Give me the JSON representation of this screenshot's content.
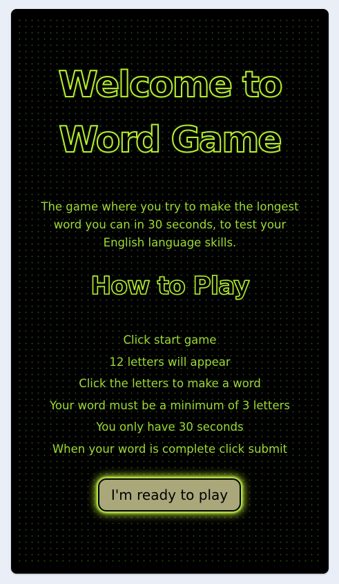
{
  "game": {
    "title_line1": "Welcome to",
    "title_line2": "Word Game",
    "intro": "The game where you try to make the longest word you can in 30 seconds, to test your English language skills.",
    "how_to_play_heading": "How to Play",
    "steps": [
      "Click start game",
      "12 letters will appear",
      "Click the letters to make a word",
      "Your word must be a minimum of 3 letters",
      "You only have 30 seconds",
      "When your word is complete click submit"
    ],
    "start_button_label": "I'm ready to play"
  },
  "colors": {
    "page_background": "#e9eef7",
    "card_background": "#000000",
    "accent_green": "#b5ef31",
    "text_green": "#9ddb35",
    "button_background": "#aaa77b"
  }
}
